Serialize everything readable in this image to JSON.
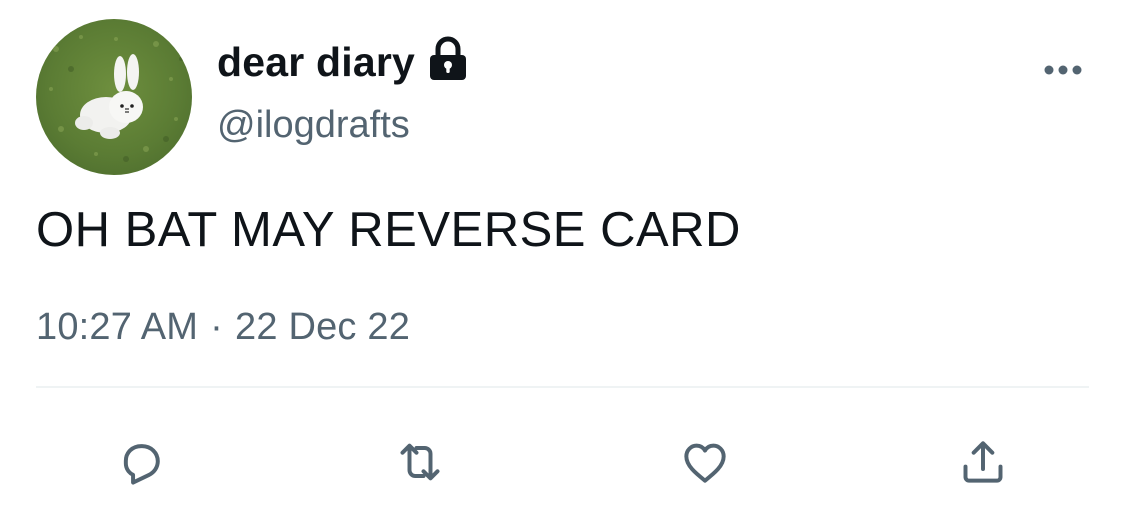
{
  "user": {
    "display_name": "dear diary",
    "handle": "@ilogdrafts",
    "protected": true
  },
  "tweet": {
    "text": "OH BAT MAY REVERSE CARD",
    "time": "10:27 AM",
    "separator": "·",
    "date": "22 Dec 22"
  },
  "icons": {
    "lock": "lock-icon",
    "more": "more-horizontal-icon",
    "reply": "reply-icon",
    "retweet": "retweet-icon",
    "like": "heart-icon",
    "share": "share-icon"
  },
  "colors": {
    "text_primary": "#0f1419",
    "text_secondary": "#536471",
    "divider": "#eff3f4",
    "icon": "#536471"
  }
}
